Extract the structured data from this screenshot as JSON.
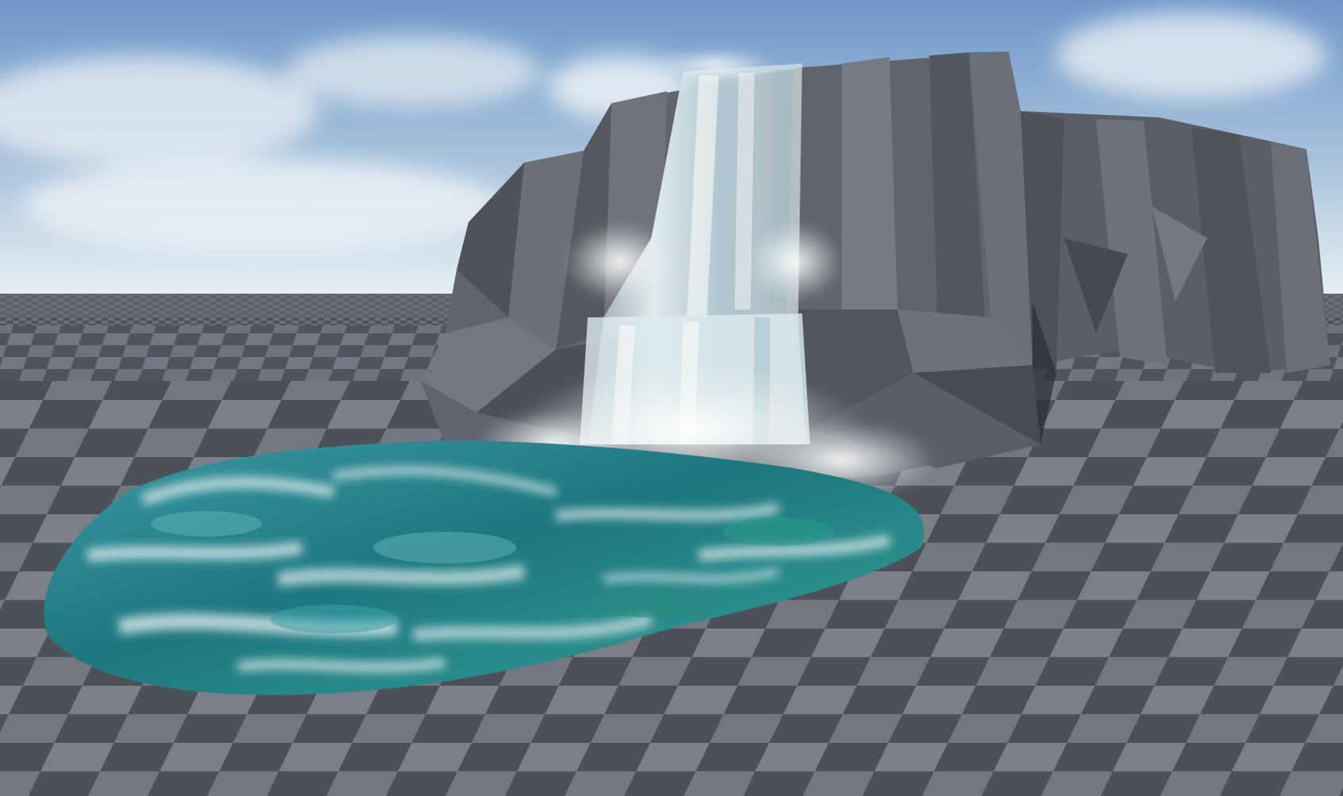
{
  "scene": {
    "kind": "3d-viewport-render",
    "subjects": [
      "sky",
      "checkerboard-ground-plane",
      "low-poly-cliff",
      "waterfall",
      "foam-spray",
      "turbulent-pool"
    ],
    "colors": {
      "sky_top": "#6f97c9",
      "sky_horizon": "#e7eff4",
      "ground_light": "#7b7f88",
      "ground_dark": "#4c5058",
      "cliff_light": "#767a82",
      "cliff_dark": "#4d5158",
      "water_deep": "#1e7780",
      "water_light": "#5fb0b4",
      "foam": "#e9f1f2"
    }
  }
}
